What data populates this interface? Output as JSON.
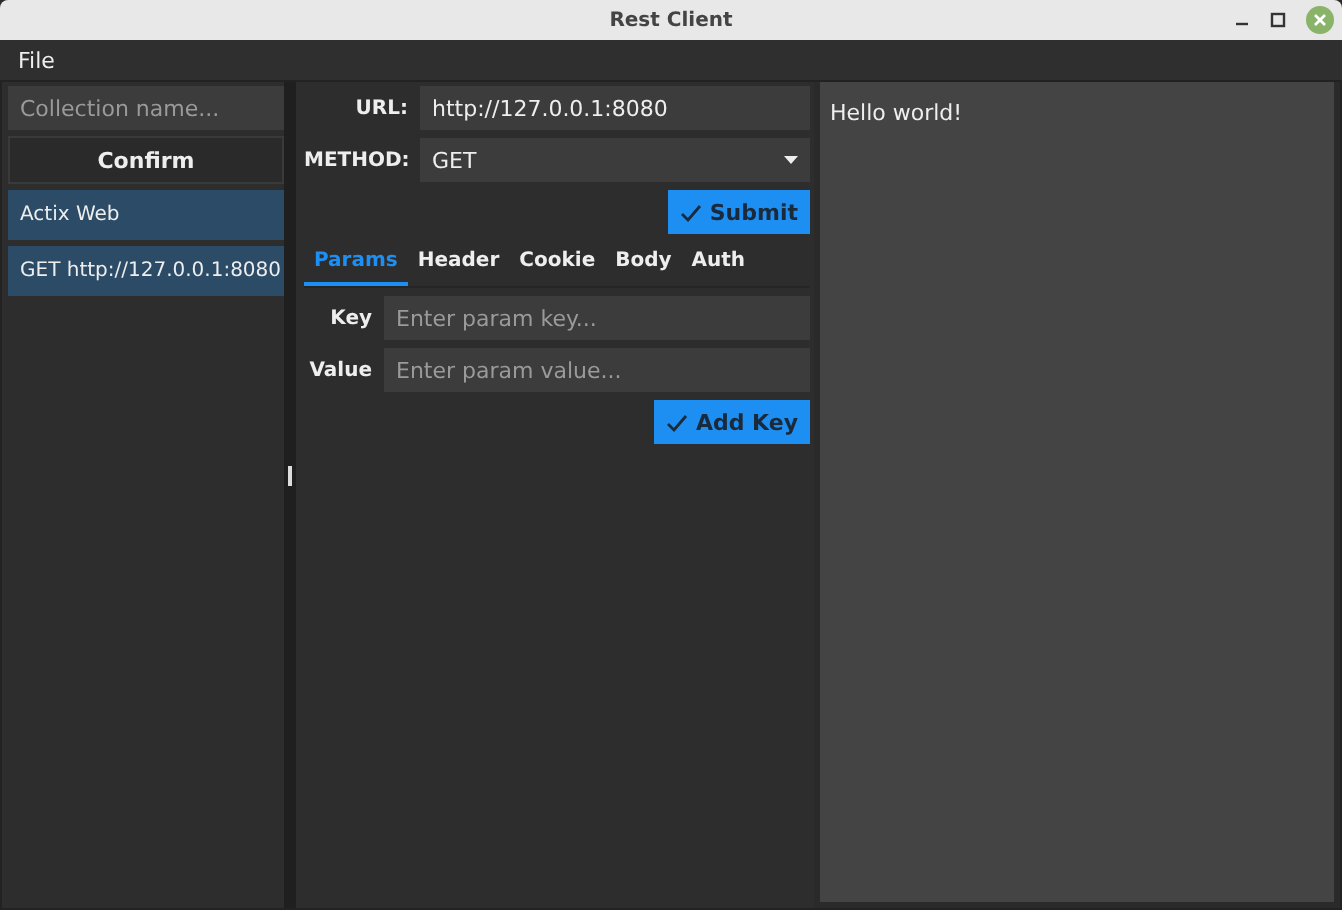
{
  "window": {
    "title": "Rest Client"
  },
  "menu": [
    "File"
  ],
  "sidebar": {
    "collection_placeholder": "Collection name...",
    "confirm": "Confirm",
    "items": [
      "Actix Web",
      "GET http://127.0.0.1:8080"
    ]
  },
  "request": {
    "url_label": "URL:",
    "url": "http://127.0.0.1:8080",
    "method_label": "METHOD:",
    "method": "GET",
    "submit": "Submit"
  },
  "tabs": [
    {
      "label": "Params",
      "selected": true
    },
    {
      "label": "Header",
      "selected": false
    },
    {
      "label": "Cookie",
      "selected": false
    },
    {
      "label": "Body",
      "selected": false
    },
    {
      "label": "Auth",
      "selected": false
    }
  ],
  "params": {
    "key_label": "Key",
    "key_placeholder": "Enter param key...",
    "value_label": "Value",
    "value_placeholder": "Enter param value...",
    "add": "Add Key"
  },
  "response": "Hello world!"
}
